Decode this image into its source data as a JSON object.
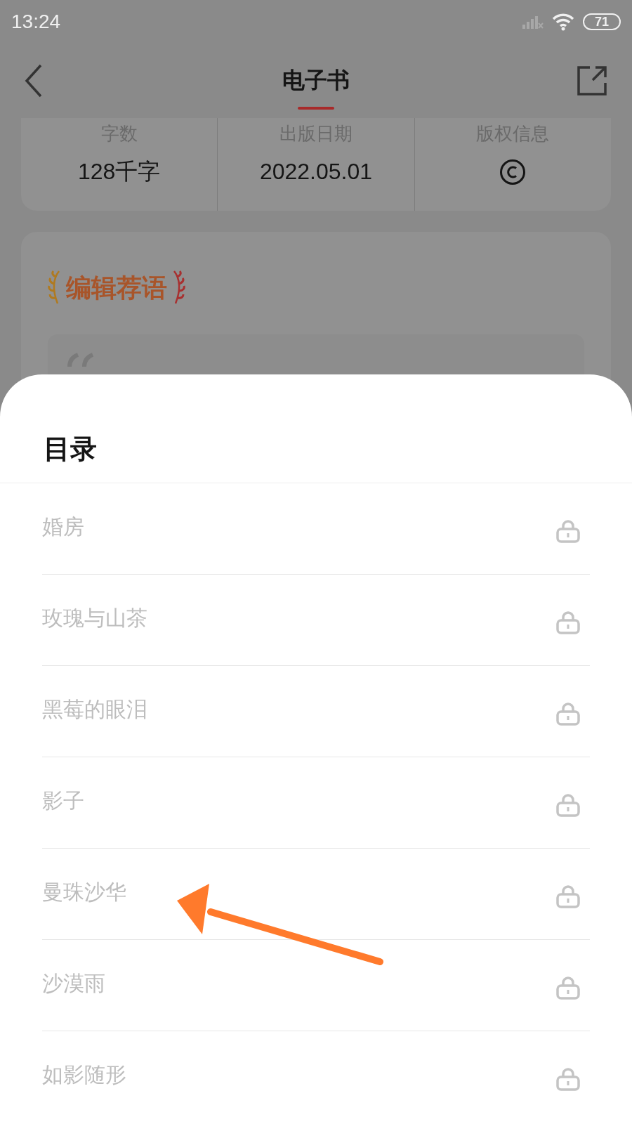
{
  "status_bar": {
    "time": "13:24",
    "battery": "71"
  },
  "header": {
    "title": "电子书",
    "tab_selected": true
  },
  "stats": [
    {
      "label": "字数",
      "value": "128千字",
      "kind": "text"
    },
    {
      "label": "出版日期",
      "value": "2022.05.01",
      "kind": "text"
    },
    {
      "label": "版权信息",
      "kind": "copyright"
    }
  ],
  "editor_section": {
    "title": "编辑荐语"
  },
  "toc_sheet": {
    "title": "目录",
    "chapters": [
      {
        "title": "婚房",
        "locked": true
      },
      {
        "title": "玫瑰与山茶",
        "locked": true
      },
      {
        "title": "黑莓的眼泪",
        "locked": true
      },
      {
        "title": "影子",
        "locked": true
      },
      {
        "title": "曼珠沙华",
        "locked": true
      },
      {
        "title": "沙漠雨",
        "locked": true
      },
      {
        "title": "如影随形",
        "locked": true
      }
    ]
  },
  "annotation": {
    "kind": "arrow"
  }
}
